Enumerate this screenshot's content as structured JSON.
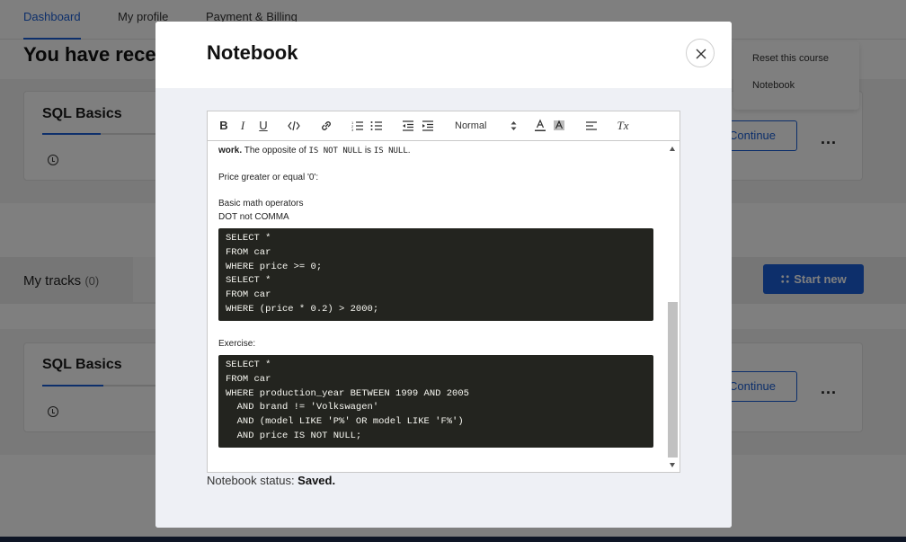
{
  "nav": {
    "tabs": [
      {
        "label": "Dashboard"
      },
      {
        "label": "My profile"
      },
      {
        "label": "Payment & Billing"
      }
    ]
  },
  "dashboard": {
    "recent_title": "You have rece",
    "courses": [
      {
        "name": "SQL Basics",
        "progress": 0.5,
        "continue_label": "Continue",
        "more_label": "..."
      },
      {
        "name": "SQL Basics",
        "progress": 0.52,
        "continue_label": "Continue",
        "more_label": "..."
      }
    ],
    "tracks": {
      "label": "My tracks",
      "count": "(0)",
      "start_new_label": "Start new"
    },
    "menu": {
      "items": [
        "Reset this course",
        "Notebook"
      ]
    }
  },
  "modal": {
    "title": "Notebook",
    "toolbar": {
      "bold": "B",
      "italic": "I",
      "underline": "U",
      "heading_select": "Normal",
      "clear_format": "Tx"
    },
    "content": {
      "line1_bold": "work.",
      "line1_text_a": " The opposite of ",
      "line1_code_a": "IS NOT NULL",
      "line1_text_b": " is ",
      "line1_code_b": "IS NULL",
      "line1_text_c": ".",
      "line2": "Price greater or equal '0':",
      "line3": "Basic math operators",
      "line4": "DOT not COMMA",
      "code1": [
        "SELECT *",
        "FROM car",
        "WHERE price >= 0;",
        "SELECT *",
        "FROM car",
        "WHERE (price * 0.2) > 2000;"
      ],
      "exercise_label": "Exercise:",
      "code2": [
        "SELECT *",
        "FROM car",
        "WHERE production_year BETWEEN 1999 AND 2005",
        "  AND brand != 'Volkswagen'",
        "  AND (model LIKE 'P%' OR model LIKE 'F%')",
        "  AND price IS NOT NULL;"
      ]
    },
    "status_label": "Notebook status: ",
    "status_value": "Saved."
  },
  "colors": {
    "accent": "#1a5fd6",
    "code_bg": "#23241f",
    "modal_body_bg": "#eef0f5"
  }
}
